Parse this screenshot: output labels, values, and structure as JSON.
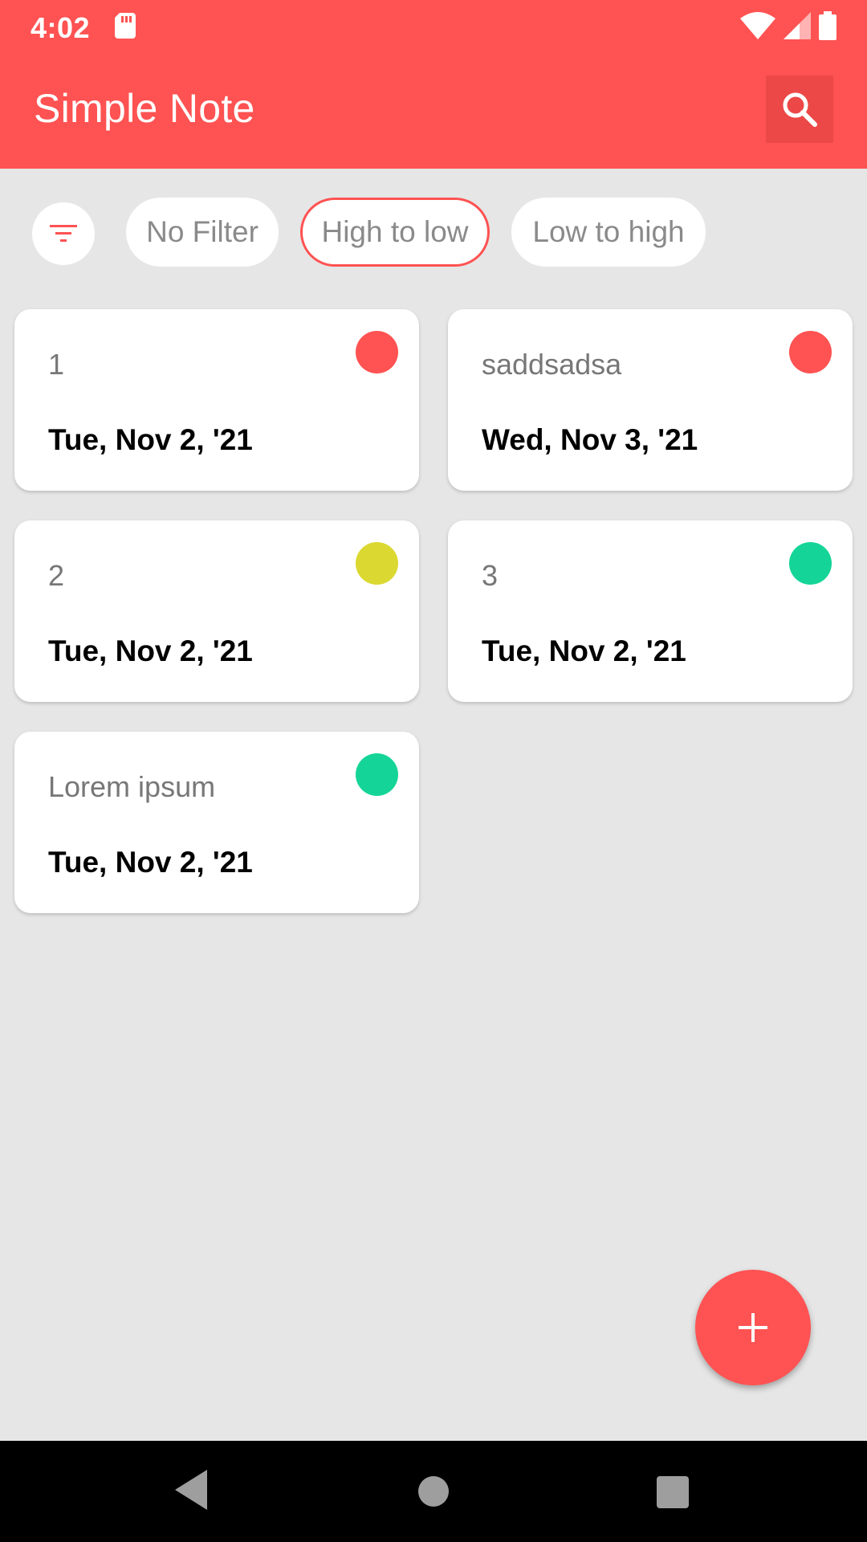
{
  "status_bar": {
    "time": "4:02",
    "icons": [
      "sd-card-icon",
      "wifi-icon",
      "cell-signal-icon",
      "battery-icon"
    ]
  },
  "toolbar": {
    "title": "Simple Note",
    "search_icon": "search-icon",
    "color": "#ff5252"
  },
  "filters": {
    "icon": "filter-icon",
    "chips": [
      {
        "label": "No Filter",
        "selected": false
      },
      {
        "label": "High to low",
        "selected": true
      },
      {
        "label": "Low to high",
        "selected": false
      }
    ]
  },
  "notes": [
    {
      "title": "1",
      "date": "Tue, Nov 2, '21",
      "priority_color": "#ff5252"
    },
    {
      "title": "saddsadsa",
      "date": "Wed, Nov 3, '21",
      "priority_color": "#ff5252"
    },
    {
      "title": "2",
      "date": "Tue, Nov 2, '21",
      "priority_color": "#dbd832"
    },
    {
      "title": "3",
      "date": "Tue, Nov 2, '21",
      "priority_color": "#14d597"
    },
    {
      "title": "Lorem ipsum",
      "date": "Tue, Nov 2, '21",
      "priority_color": "#14d597"
    }
  ],
  "fab": {
    "icon": "plus-icon"
  },
  "nav_bar": {
    "icons": [
      "back-icon",
      "home-icon",
      "recents-icon"
    ]
  }
}
